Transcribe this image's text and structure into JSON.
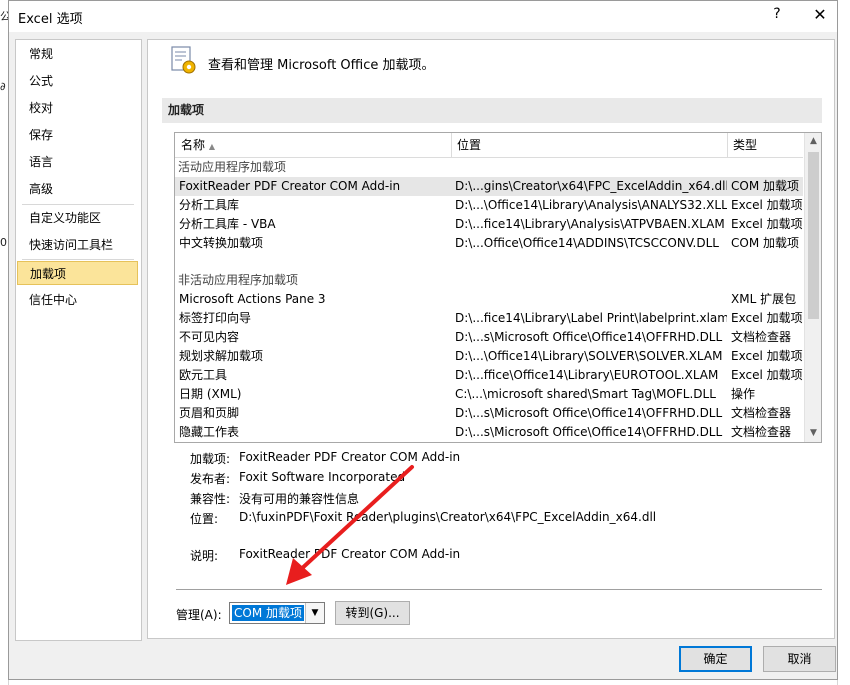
{
  "background": {
    "left_fragments": [
      "公",
      "∂",
      "0."
    ],
    "right_fragments": [
      "",
      ""
    ]
  },
  "dialog": {
    "title": "Excel 选项",
    "help": "?",
    "close": "✕"
  },
  "nav": {
    "items": [
      {
        "label": "常规"
      },
      {
        "label": "公式"
      },
      {
        "label": "校对"
      },
      {
        "label": "保存"
      },
      {
        "label": "语言"
      },
      {
        "label": "高级"
      },
      {
        "label": "自定义功能区"
      },
      {
        "label": "快速访问工具栏"
      },
      {
        "label": "加载项"
      },
      {
        "label": "信任中心"
      }
    ],
    "active_index": 8
  },
  "content": {
    "header": "查看和管理 Microsoft Office 加载项。",
    "section_title": "加载项",
    "columns": {
      "name": "名称",
      "location": "位置",
      "type": "类型",
      "sort_indicator": "▲"
    },
    "groups": {
      "active": "活动应用程序加载项",
      "inactive": "非活动应用程序加载项"
    },
    "active_rows": [
      {
        "name": "FoxitReader PDF Creator COM Add-in",
        "location": "D:\\...gins\\Creator\\x64\\FPC_ExcelAddin_x64.dll",
        "type": "COM 加载项"
      },
      {
        "name": "分析工具库",
        "location": "D:\\...\\Office14\\Library\\Analysis\\ANALYS32.XLL",
        "type": "Excel 加载项"
      },
      {
        "name": "分析工具库 - VBA",
        "location": "D:\\...fice14\\Library\\Analysis\\ATPVBAEN.XLAM",
        "type": "Excel 加载项"
      },
      {
        "name": "中文转换加载项",
        "location": "D:\\...Office\\Office14\\ADDINS\\TCSCCONV.DLL",
        "type": "COM 加载项"
      }
    ],
    "inactive_rows": [
      {
        "name": "Microsoft Actions Pane 3",
        "location": "",
        "type": "XML 扩展包"
      },
      {
        "name": "标签打印向导",
        "location": "D:\\...fice14\\Library\\Label Print\\labelprint.xlam",
        "type": "Excel 加载项"
      },
      {
        "name": "不可见内容",
        "location": "D:\\...s\\Microsoft Office\\Office14\\OFFRHD.DLL",
        "type": "文档检查器"
      },
      {
        "name": "规划求解加载项",
        "location": "D:\\...\\Office14\\Library\\SOLVER\\SOLVER.XLAM",
        "type": "Excel 加载项"
      },
      {
        "name": "欧元工具",
        "location": "D:\\...ffice\\Office14\\Library\\EUROTOOL.XLAM",
        "type": "Excel 加载项"
      },
      {
        "name": "日期 (XML)",
        "location": "C:\\...\\microsoft shared\\Smart Tag\\MOFL.DLL",
        "type": "操作"
      },
      {
        "name": "页眉和页脚",
        "location": "D:\\...s\\Microsoft Office\\Office14\\OFFRHD.DLL",
        "type": "文档检查器"
      },
      {
        "name": "隐藏工作表",
        "location": "D:\\...s\\Microsoft Office\\Office14\\OFFRHD.DLL",
        "type": "文档检查器"
      }
    ],
    "details": {
      "addin_label": "加载项:",
      "addin_value": "FoxitReader PDF Creator COM Add-in",
      "publisher_label": "发布者:",
      "publisher_value": "Foxit Software Incorporated",
      "compat_label": "兼容性:",
      "compat_value": "没有可用的兼容性信息",
      "location_label": "位置:",
      "location_value": "D:\\fuxinPDF\\Foxit Reader\\plugins\\Creator\\x64\\FPC_ExcelAddin_x64.dll",
      "desc_label": "说明:",
      "desc_value": "FoxitReader PDF Creator COM Add-in"
    },
    "manage": {
      "label": "管理(A):",
      "selected": "COM 加载项",
      "go_label": "转到(G)..."
    }
  },
  "buttons": {
    "ok": "确定",
    "cancel": "取消"
  },
  "colors": {
    "accent": "#0078d7",
    "nav_active": "#fbe49a",
    "annotation_arrow": "#e81e1e"
  }
}
